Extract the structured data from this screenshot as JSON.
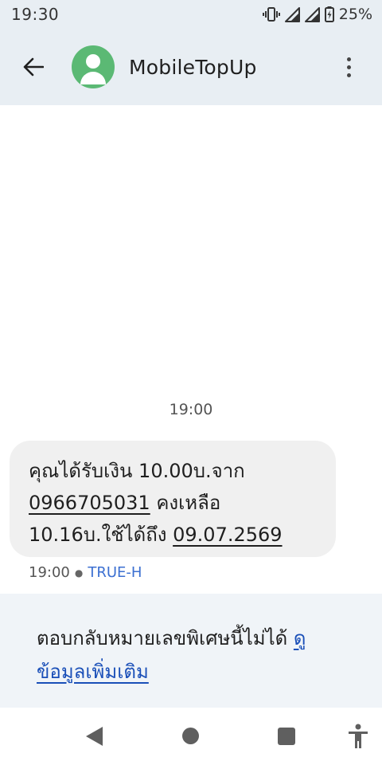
{
  "status_bar": {
    "time": "19:30",
    "battery_percent": "25%",
    "icons": [
      "vibrate-icon",
      "signal-icon",
      "signal-icon",
      "battery-charging-icon"
    ]
  },
  "app_bar": {
    "contact_name": "MobileTopUp",
    "icons": [
      "back-arrow-icon",
      "contact-avatar-icon",
      "more-vert-icon"
    ]
  },
  "conversation": {
    "date_divider": "19:00",
    "message": {
      "line1": "คุณได้รับเงิน 10.00บ.จาก",
      "phone": "0966705031",
      "line2_rest": " คงเหลือ",
      "line3_start": "10.16บ.ใช้ได้ถึง ",
      "date": "09.07.2569",
      "time": "19:00",
      "sim": "TRUE-H"
    }
  },
  "reply_panel": {
    "text": "ตอบกลับหมายเลขพิเศษนี้ไม่ได้ ",
    "link_part1": "ดู",
    "link_part2": "ข้อมูลเพิ่มเติม"
  },
  "nav_bar": {
    "icons": [
      "nav-back-icon",
      "nav-home-icon",
      "nav-recents-icon",
      "accessibility-icon"
    ]
  },
  "colors": {
    "header_bg": "#e8eef3",
    "avatar": "#5bb974",
    "bubble": "#f0f0f0",
    "sim_label": "#3b6fd1",
    "link": "#1a4fb8"
  }
}
